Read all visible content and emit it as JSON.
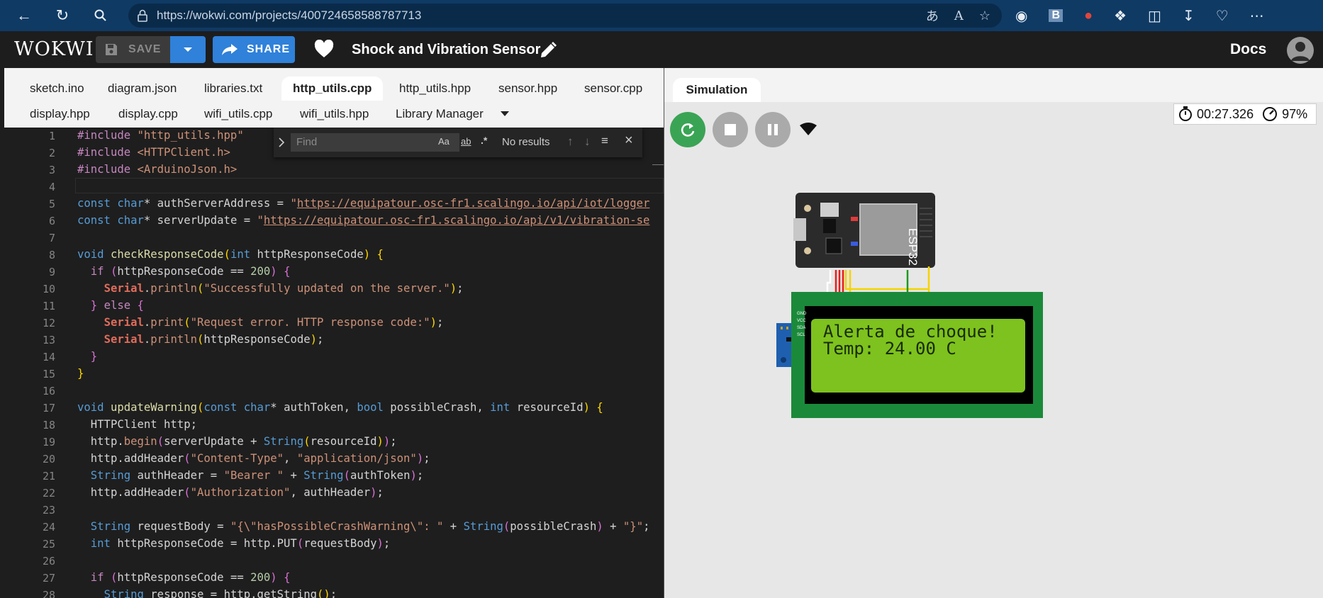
{
  "browser": {
    "url": "https://wokwi.com/projects/400724658588787713"
  },
  "header": {
    "logo": "WOKWI",
    "save_label": "SAVE",
    "share_label": "SHARE",
    "project_title": "Shock and Vibration Sensor",
    "docs_label": "Docs"
  },
  "tabs": [
    {
      "label": "sketch.ino"
    },
    {
      "label": "diagram.json"
    },
    {
      "label": "libraries.txt"
    },
    {
      "label": "http_utils.cpp",
      "active": true
    },
    {
      "label": "http_utils.hpp"
    },
    {
      "label": "sensor.hpp"
    },
    {
      "label": "sensor.cpp"
    },
    {
      "label": "display.hpp"
    },
    {
      "label": "display.cpp"
    },
    {
      "label": "wifi_utils.cpp"
    },
    {
      "label": "wifi_utils.hpp"
    },
    {
      "label": "Library Manager"
    }
  ],
  "find": {
    "placeholder": "Find",
    "result": "No results",
    "opt_case": "Aa",
    "opt_word": "ab",
    "opt_regex": ".*"
  },
  "code": {
    "line_numbers": [
      "1",
      "2",
      "3",
      "4",
      "5",
      "6",
      "7",
      "8",
      "9",
      "10",
      "11",
      "12",
      "13",
      "14",
      "15",
      "16",
      "17",
      "18",
      "19",
      "20",
      "21",
      "22",
      "23",
      "24",
      "25",
      "26",
      "27",
      "28"
    ]
  },
  "simulation": {
    "tab_label": "Simulation",
    "timer": "00:27.326",
    "speed": "97%",
    "board_label": "ESP32",
    "lcd_line1": "Alerta de choque!",
    "lcd_line2": "Temp: 24.00 C",
    "lcd_pins": [
      "GND",
      "VCC",
      "SDA",
      "SCL"
    ]
  },
  "colors": {
    "browser_bar": "#0f3a64",
    "accent_blue": "#2f81d9",
    "lcd_green": "#7dc21e",
    "pcb_green": "#1a8a3a"
  }
}
